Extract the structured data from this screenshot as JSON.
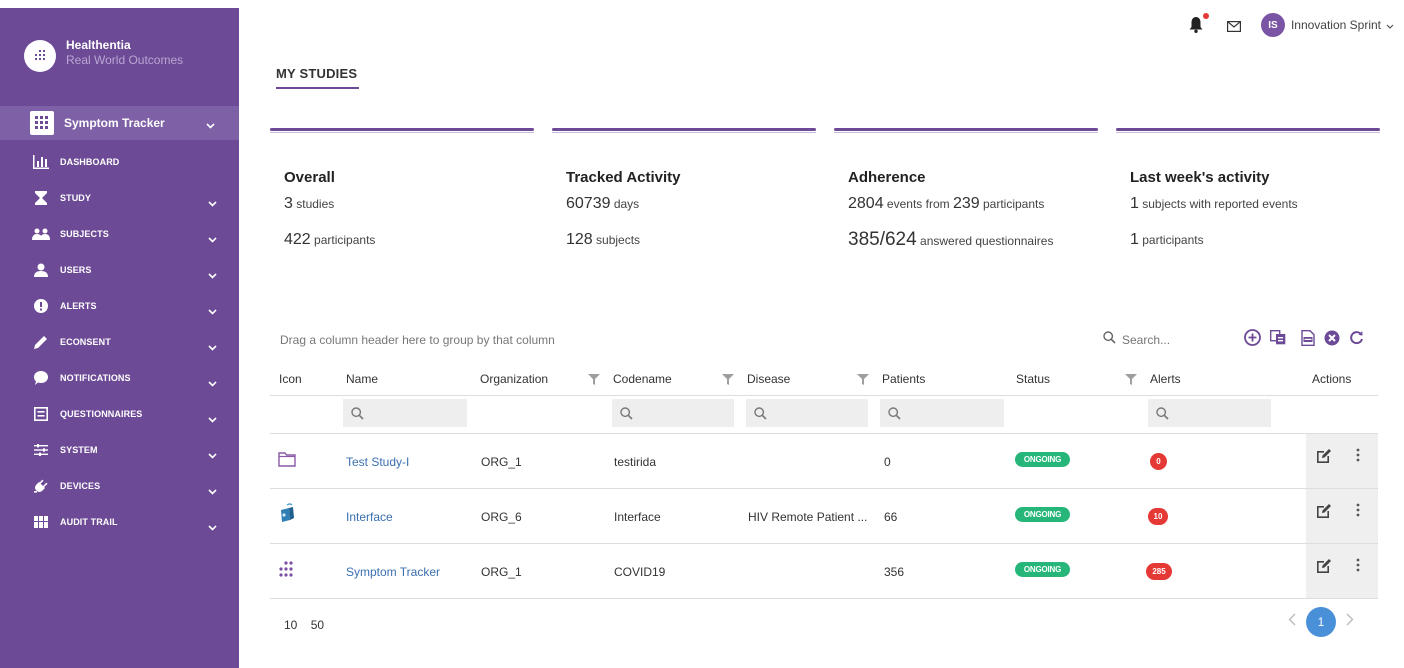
{
  "brand": {
    "name": "Healthentia",
    "subtitle": "Real World Outcomes"
  },
  "app_selector": {
    "label": "Symptom Tracker"
  },
  "sidebar": {
    "items": [
      {
        "label": "DASHBOARD",
        "icon": "bar-chart-icon",
        "has_chevron": false
      },
      {
        "label": "STUDY",
        "icon": "hourglass-icon",
        "has_chevron": true
      },
      {
        "label": "SUBJECTS",
        "icon": "group-icon",
        "has_chevron": true
      },
      {
        "label": "USERS",
        "icon": "user-icon",
        "has_chevron": true
      },
      {
        "label": "ALERTS",
        "icon": "exclamation-circle-icon",
        "has_chevron": true
      },
      {
        "label": "ECONSENT",
        "icon": "pencil-icon",
        "has_chevron": true
      },
      {
        "label": "NOTIFICATIONS",
        "icon": "chat-bubble-icon",
        "has_chevron": true
      },
      {
        "label": "QUESTIONNAIRES",
        "icon": "list-box-icon",
        "has_chevron": true
      },
      {
        "label": "SYSTEM",
        "icon": "sliders-icon",
        "has_chevron": true
      },
      {
        "label": "DEVICES",
        "icon": "plug-icon",
        "has_chevron": true
      },
      {
        "label": "AUDIT TRAIL",
        "icon": "grid-icon",
        "has_chevron": true
      }
    ]
  },
  "topbar": {
    "user_initials": "IS",
    "user_name": "Innovation Sprint"
  },
  "page": {
    "title": "MY STUDIES"
  },
  "stats": {
    "overall": {
      "title": "Overall",
      "line1_value": "3",
      "line1_unit": " studies",
      "line2_value": "422",
      "line2_unit": " participants"
    },
    "tracked": {
      "title": "Tracked Activity",
      "line1_value": "60739",
      "line1_unit": " days",
      "line2_value": "128",
      "line2_unit": " subjects"
    },
    "adherence": {
      "title": "Adherence",
      "line1_value": "2804",
      "line1_mid": " events from ",
      "line1_value2": "239",
      "line1_unit": " participants",
      "line2_value": "385/624",
      "line2_unit": " answered questionnaires"
    },
    "lastweek": {
      "title": "Last week's activity",
      "line1_value": "1",
      "line1_unit": " subjects with reported events",
      "line2_value": "1",
      "line2_unit": " participants"
    }
  },
  "grid": {
    "group_hint": "Drag a column header here to group by that column",
    "search_placeholder": "Search...",
    "columns": {
      "icon": "Icon",
      "name": "Name",
      "organization": "Organization",
      "codename": "Codename",
      "disease": "Disease",
      "patients": "Patients",
      "status": "Status",
      "alerts": "Alerts",
      "actions": "Actions"
    },
    "rows": [
      {
        "icon": "folder-icon",
        "name": "Test Study-I",
        "organization": "ORG_1",
        "codename": "testirida",
        "disease": "",
        "patients": "0",
        "status": "ONGOING",
        "alerts": "0"
      },
      {
        "icon": "interface-icon",
        "name": "Interface",
        "organization": "ORG_6",
        "codename": "Interface",
        "disease": "HIV Remote Patient ...",
        "patients": "66",
        "status": "ONGOING",
        "alerts": "10"
      },
      {
        "icon": "symptom-tracker-icon",
        "name": "Symptom Tracker",
        "organization": "ORG_1",
        "codename": "COVID19",
        "disease": "",
        "patients": "356",
        "status": "ONGOING",
        "alerts": "285"
      }
    ],
    "page_sizes": [
      "10",
      "50"
    ],
    "current_page": "1"
  },
  "colors": {
    "sidebar": "#6d4a96",
    "accent": "#6d4a96",
    "status_ongoing": "#27b67a",
    "alert": "#e53935",
    "pager_active": "#4a90d9",
    "link": "#3a6fb0"
  }
}
